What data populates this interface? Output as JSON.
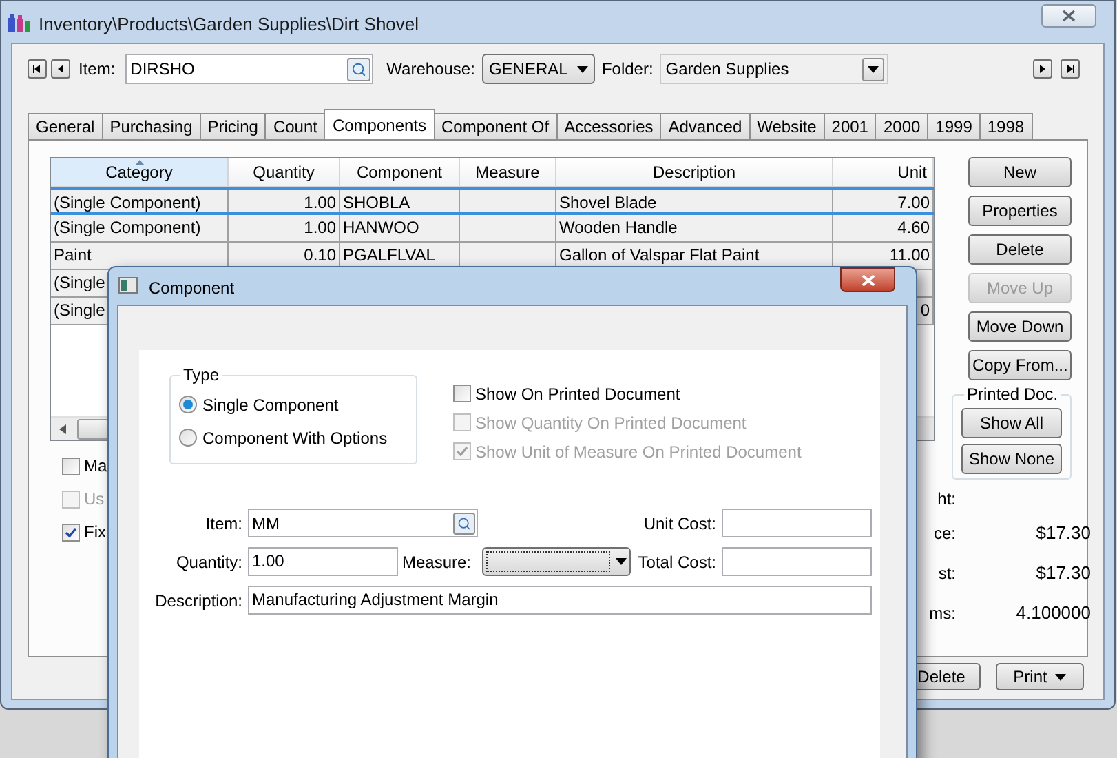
{
  "window": {
    "title": "Inventory\\Products\\Garden Supplies\\Dirt Shovel"
  },
  "toolbar": {
    "item_label": "Item:",
    "item_value": "DIRSHO",
    "warehouse_label": "Warehouse:",
    "warehouse_value": "GENERAL",
    "folder_label": "Folder:",
    "folder_value": "Garden Supplies"
  },
  "tabs": [
    {
      "label": "General",
      "selected": false
    },
    {
      "label": "Purchasing",
      "selected": false
    },
    {
      "label": "Pricing",
      "selected": false
    },
    {
      "label": "Count",
      "selected": false
    },
    {
      "label": "Components",
      "selected": true
    },
    {
      "label": "Component Of",
      "selected": false
    },
    {
      "label": "Accessories",
      "selected": false
    },
    {
      "label": "Advanced",
      "selected": false
    },
    {
      "label": "Website",
      "selected": false
    },
    {
      "label": "2001",
      "selected": false
    },
    {
      "label": "2000",
      "selected": false
    },
    {
      "label": "1999",
      "selected": false
    },
    {
      "label": "1998",
      "selected": false
    }
  ],
  "table": {
    "columns": [
      "Category",
      "Quantity",
      "Component",
      "Measure",
      "Description",
      "Unit"
    ],
    "rows": [
      {
        "selected": true,
        "cells": [
          "(Single Component)",
          "1.00",
          "SHOBLA",
          "",
          "Shovel Blade",
          "7.00"
        ]
      },
      {
        "selected": false,
        "cells": [
          "(Single Component)",
          "1.00",
          "HANWOO",
          "",
          "Wooden Handle",
          "4.60"
        ]
      },
      {
        "selected": false,
        "cells": [
          "Paint",
          "0.10",
          "PGALFLVAL",
          "",
          "Gallon of Valspar Flat Paint",
          "11.00"
        ]
      },
      {
        "selected": false,
        "cells": [
          "(Single",
          "",
          "",
          "",
          "",
          ""
        ]
      },
      {
        "selected": false,
        "cells": [
          "(Single",
          "",
          "",
          "",
          "",
          "0"
        ]
      }
    ]
  },
  "side_buttons": [
    {
      "label": "New",
      "disabled": false
    },
    {
      "label": "Properties",
      "disabled": false
    },
    {
      "label": "Delete",
      "disabled": false
    },
    {
      "label": "Move Up",
      "disabled": true
    },
    {
      "label": "Move Down",
      "disabled": false
    },
    {
      "label": "Copy From...",
      "disabled": false
    }
  ],
  "printed_doc": {
    "title": "Printed Doc.",
    "buttons": [
      "Show All",
      "Show None"
    ]
  },
  "options": [
    {
      "label": "Ma",
      "checked": false,
      "disabled": false
    },
    {
      "label": "Us",
      "checked": false,
      "disabled": true
    },
    {
      "label": "Fix",
      "checked": true,
      "disabled": false
    }
  ],
  "totals": [
    {
      "label": "ht:"
    },
    {
      "label": "ce:",
      "value": "$17.30"
    },
    {
      "label": "st:",
      "value": "$17.30"
    },
    {
      "label": "ms:",
      "value": "4.100000"
    }
  ],
  "footer_buttons": [
    {
      "label": "Delete",
      "kind": "plain"
    },
    {
      "label": "Print",
      "kind": "menu"
    }
  ],
  "dialog": {
    "title": "Component",
    "type_group": {
      "title": "Type",
      "options": [
        {
          "label": "Single Component",
          "selected": true
        },
        {
          "label": "Component With Options",
          "selected": false
        }
      ]
    },
    "print_options": [
      {
        "label": "Show On Printed Document",
        "checked": false,
        "disabled": false
      },
      {
        "label": "Show Quantity On Printed Document",
        "checked": false,
        "disabled": true
      },
      {
        "label": "Show Unit of Measure On Printed Document",
        "checked": true,
        "disabled": true
      }
    ],
    "item": {
      "label": "Item:",
      "value": "MM"
    },
    "unit_cost": {
      "label": "Unit Cost:"
    },
    "quantity": {
      "label": "Quantity:",
      "value": "1.00"
    },
    "measure": {
      "label": "Measure:"
    },
    "total_cost": {
      "label": "Total Cost:"
    },
    "description": {
      "label": "Description:",
      "value": "Manufacturing Adjustment Margin"
    }
  }
}
